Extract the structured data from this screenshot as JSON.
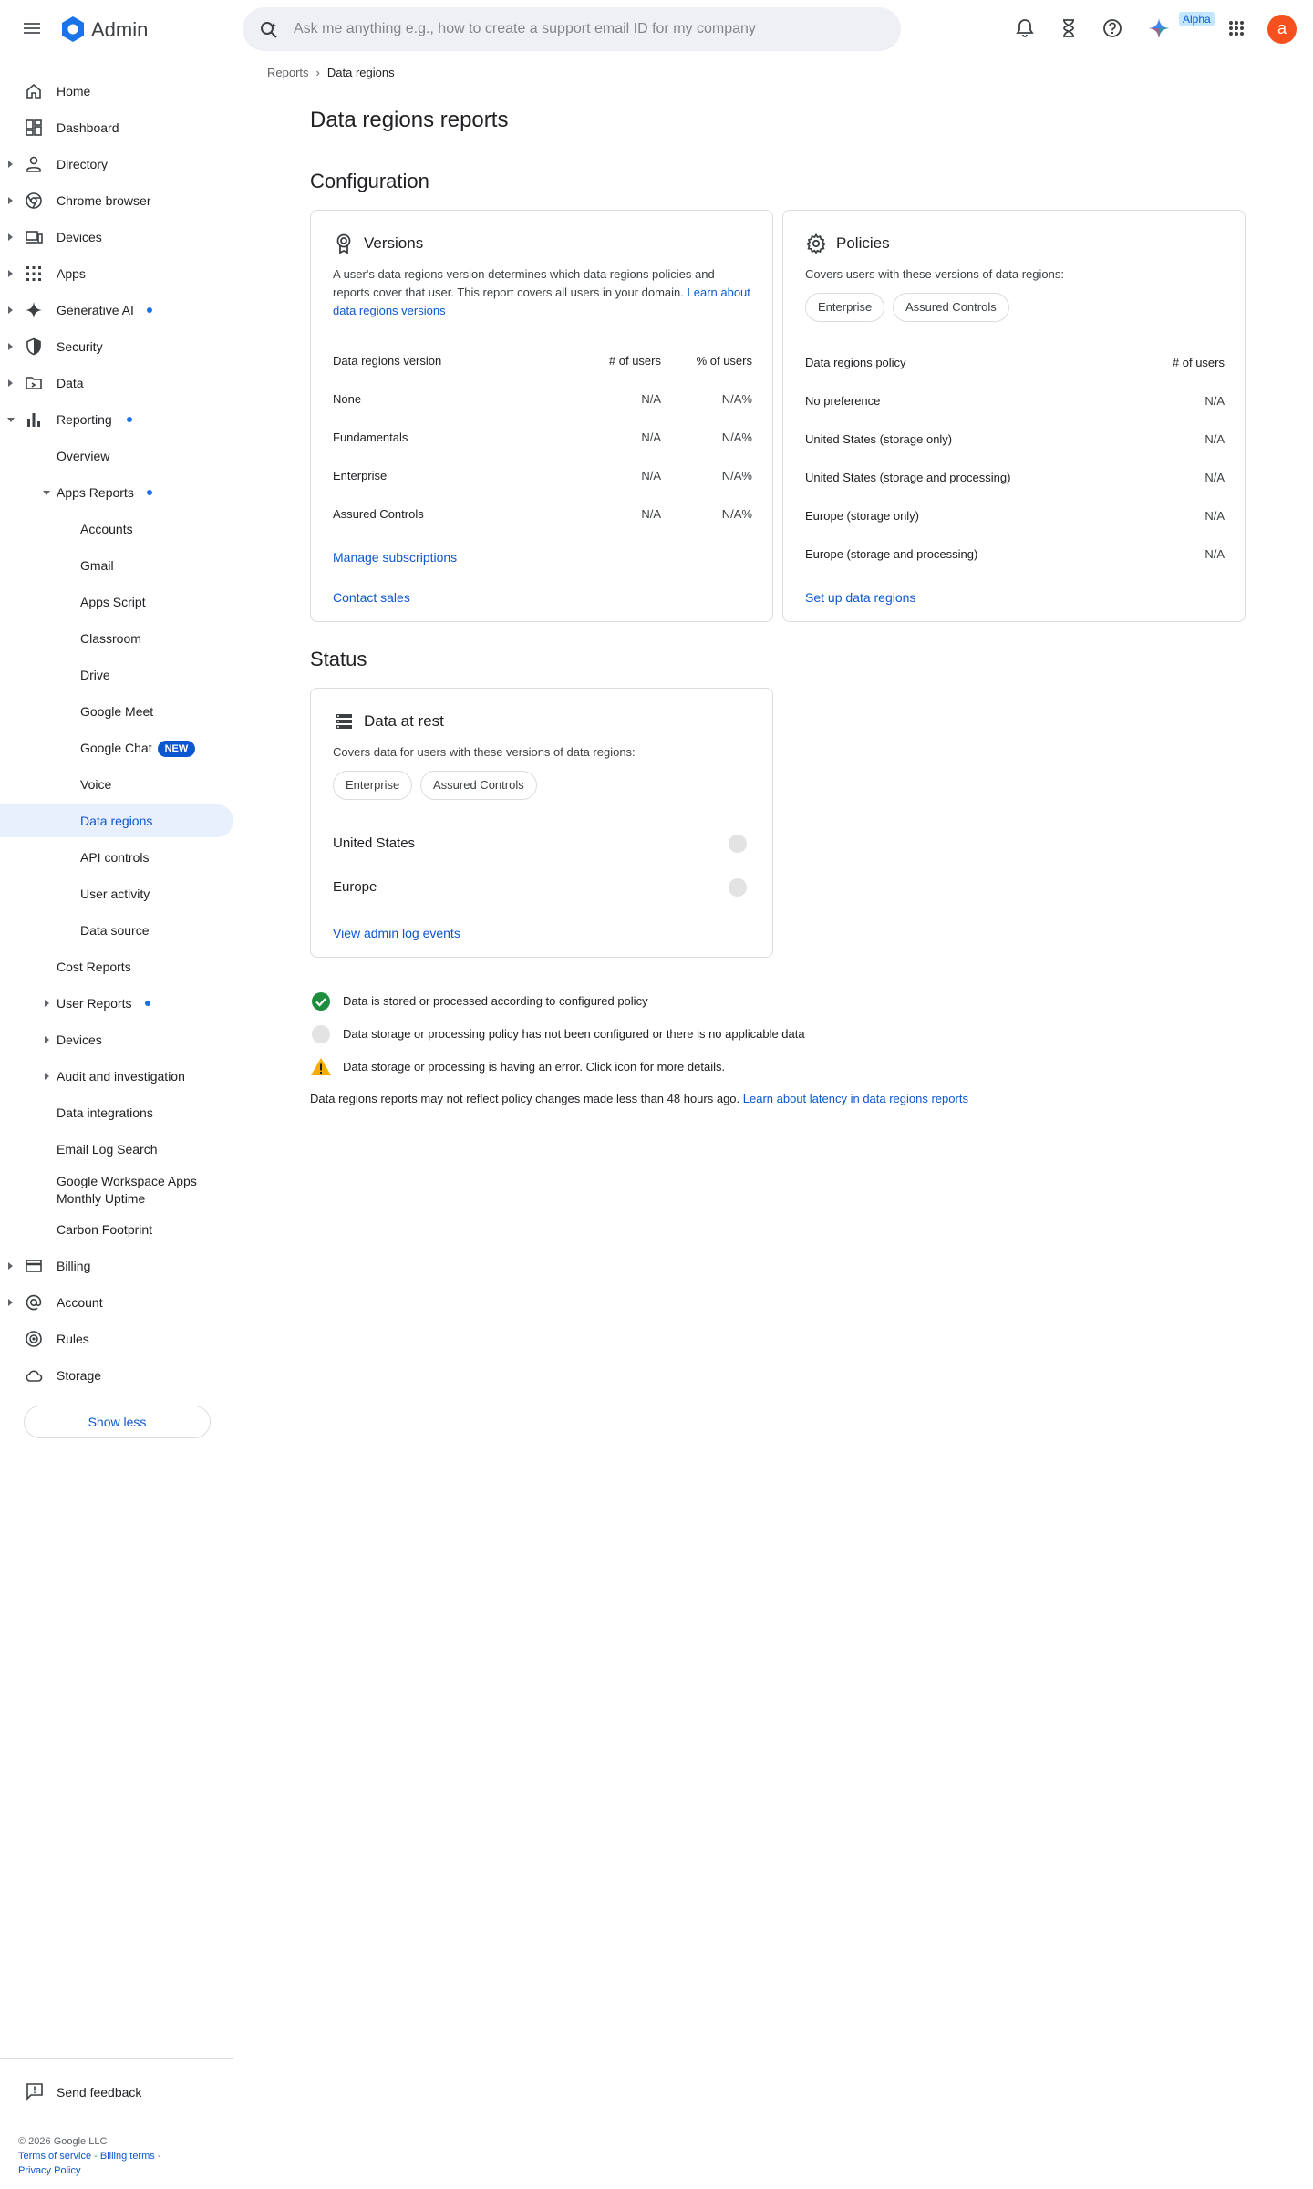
{
  "header": {
    "app_title": "Admin",
    "search_placeholder": "Ask me anything e.g., how to create a support email ID for my company",
    "alpha_badge": "Alpha",
    "avatar_letter": "a"
  },
  "sidebar": {
    "items": [
      {
        "label": "Home"
      },
      {
        "label": "Dashboard"
      },
      {
        "label": "Directory"
      },
      {
        "label": "Chrome browser"
      },
      {
        "label": "Devices"
      },
      {
        "label": "Apps"
      },
      {
        "label": "Generative AI"
      },
      {
        "label": "Security"
      },
      {
        "label": "Data"
      },
      {
        "label": "Reporting"
      },
      {
        "label": "Overview"
      },
      {
        "label": "Apps Reports"
      },
      {
        "label": "Accounts"
      },
      {
        "label": "Gmail"
      },
      {
        "label": "Apps Script"
      },
      {
        "label": "Classroom"
      },
      {
        "label": "Drive"
      },
      {
        "label": "Google Meet"
      },
      {
        "label": "Google Chat"
      },
      {
        "label": "Voice"
      },
      {
        "label": "Data regions"
      },
      {
        "label": "API controls"
      },
      {
        "label": "User activity"
      },
      {
        "label": "Data source"
      },
      {
        "label": "Cost Reports"
      },
      {
        "label": "User Reports"
      },
      {
        "label": "Devices"
      },
      {
        "label": "Audit and investigation"
      },
      {
        "label": "Data integrations"
      },
      {
        "label": "Email Log Search"
      },
      {
        "label": "Google Workspace Apps Monthly Uptime"
      },
      {
        "label": "Carbon Footprint"
      },
      {
        "label": "Billing"
      },
      {
        "label": "Account"
      },
      {
        "label": "Rules"
      },
      {
        "label": "Storage"
      }
    ],
    "new_badge": "NEW",
    "show_less": "Show less",
    "send_feedback": "Send feedback"
  },
  "footer": {
    "copyright": "© 2026 Google LLC",
    "terms": "Terms of service",
    "billing_terms": "Billing terms",
    "privacy": "Privacy Policy"
  },
  "breadcrumb": {
    "parent": "Reports",
    "separator": "›",
    "current": "Data regions"
  },
  "page_title": "Data regions reports",
  "configuration": {
    "heading": "Configuration",
    "versions": {
      "title": "Versions",
      "description": "A user's data regions version determines which data regions policies and reports cover that user. This report covers all users in your domain.",
      "learn_link": "Learn about data regions versions",
      "columns": [
        "Data regions version",
        "# of users",
        "% of users"
      ],
      "rows": [
        {
          "name": "None",
          "users": "N/A",
          "pct": "N/A%"
        },
        {
          "name": "Fundamentals",
          "users": "N/A",
          "pct": "N/A%"
        },
        {
          "name": "Enterprise",
          "users": "N/A",
          "pct": "N/A%"
        },
        {
          "name": "Assured Controls",
          "users": "N/A",
          "pct": "N/A%"
        }
      ],
      "manage_link": "Manage subscriptions",
      "contact_link": "Contact sales"
    },
    "policies": {
      "title": "Policies",
      "covers": "Covers users with these versions of data regions:",
      "chips": [
        "Enterprise",
        "Assured Controls"
      ],
      "columns": [
        "Data regions policy",
        "# of users"
      ],
      "rows": [
        {
          "name": "No preference",
          "users": "N/A"
        },
        {
          "name": "United States (storage only)",
          "users": "N/A"
        },
        {
          "name": "United States (storage and processing)",
          "users": "N/A"
        },
        {
          "name": "Europe (storage only)",
          "users": "N/A"
        },
        {
          "name": "Europe (storage and processing)",
          "users": "N/A"
        }
      ],
      "setup_link": "Set up data regions"
    }
  },
  "status": {
    "heading": "Status",
    "data_at_rest": {
      "title": "Data at rest",
      "covers": "Covers data for users with these versions of data regions:",
      "chips": [
        "Enterprise",
        "Assured Controls"
      ],
      "regions": [
        "United States",
        "Europe"
      ],
      "log_link": "View admin log events"
    }
  },
  "legend": {
    "ok": "Data is stored or processed according to configured policy",
    "none": "Data storage or processing policy has not been configured or there is no applicable data",
    "error": "Data storage or processing is having an error. Click icon for more details.",
    "note": "Data regions reports may not reflect policy changes made less than 48 hours ago.",
    "latency_link": "Learn about latency in data regions reports"
  },
  "colors": {
    "accent": "#0b57d0",
    "active_bg": "#e8f0fe",
    "ok": "#1e8e3e",
    "warn": "#f9ab00",
    "avatar": "#f4511e"
  }
}
